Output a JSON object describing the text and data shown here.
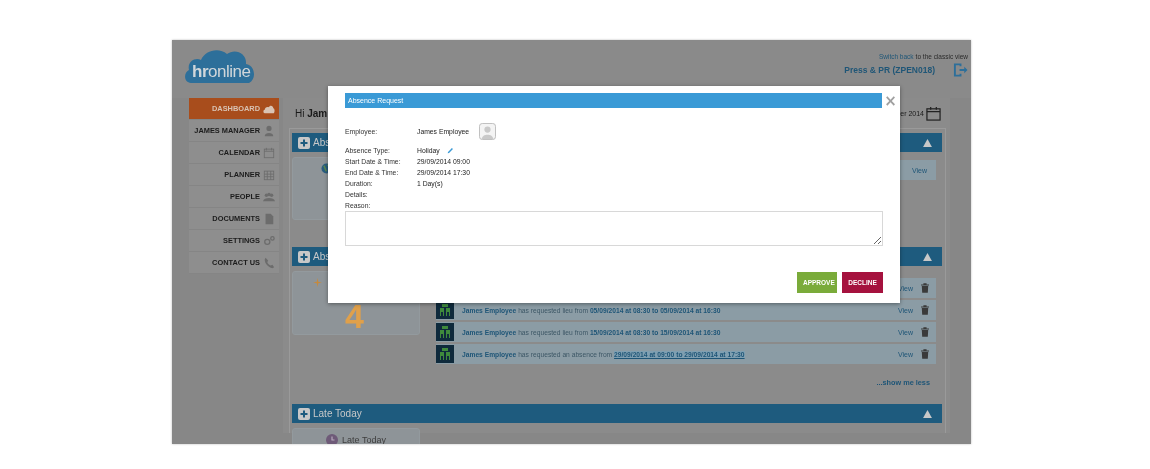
{
  "header": {
    "logo": "**hr**online",
    "switch_link": "Switch back",
    "switch_text": "to the classic view",
    "account": "Press & PR (ZPEN018)"
  },
  "sidebar": {
    "items": [
      {
        "label": "DASHBOARD",
        "kind": "cloud",
        "selected": true
      },
      {
        "label": "JAMES MANAGER",
        "kind": "person",
        "selected": false
      },
      {
        "label": "CALENDAR",
        "kind": "calendar",
        "selected": false
      },
      {
        "label": "PLANNER",
        "kind": "grid",
        "selected": false
      },
      {
        "label": "PEOPLE",
        "kind": "people",
        "selected": false
      },
      {
        "label": "DOCUMENTS",
        "kind": "document",
        "selected": false
      },
      {
        "label": "SETTINGS",
        "kind": "gears",
        "selected": false
      },
      {
        "label": "CONTACT US",
        "kind": "phone",
        "selected": false
      }
    ]
  },
  "greeting": "Hi **Jam**",
  "date": "er 2014",
  "sections": [
    {
      "title": "Abs",
      "card": {
        "kind": "globe"
      },
      "rows": [
        {
          "view": "View",
          "deletable": false
        }
      ]
    },
    {
      "title": "Abs",
      "card": {
        "kind": "count",
        "value": "4"
      },
      "rows": [
        {
          "view": "View",
          "deletable": true
        },
        {
          "name": "James Employee",
          "action": "has requested lieu from",
          "period": "05/09/2014 at 08:30 to 05/09/2014 at 16:30",
          "highlighted": false,
          "view": "View",
          "deletable": true
        },
        {
          "name": "James Employee",
          "action": "has requested lieu from",
          "period": "15/09/2014 at 08:30 to 15/09/2014 at 16:30",
          "highlighted": false,
          "view": "View",
          "deletable": true
        },
        {
          "name": "James Employee",
          "action": "has requested an absence from",
          "period": "29/09/2014 at 09:00 to 29/09/2014 at 17:30",
          "highlighted": true,
          "view": "View",
          "deletable": true
        }
      ],
      "more": "...show me less"
    },
    {
      "title": "Late Today",
      "card": {
        "kind": "clock",
        "label": "Late Today"
      }
    }
  ],
  "modal": {
    "title": "Absence Request",
    "close": "×",
    "fields": [
      {
        "kind": "employee",
        "label": "Employee:",
        "value": "James Employee"
      },
      {
        "kind": "editable",
        "label": "Absence Type:",
        "value": "Holiday"
      },
      {
        "kind": "text",
        "label": "Start Date & Time:",
        "value": "29/09/2014 09:00"
      },
      {
        "kind": "text",
        "label": "End Date & Time:",
        "value": "29/09/2014 17:30"
      },
      {
        "kind": "text",
        "label": "Duration:",
        "value": "1 Day(s)"
      },
      {
        "kind": "text",
        "label": "Details:"
      },
      {
        "kind": "text",
        "label": "Reason:"
      }
    ],
    "buttons": [
      {
        "label": "APPROVE",
        "kind": "approve"
      },
      {
        "label": "DECLINE",
        "kind": "decline"
      }
    ]
  }
}
